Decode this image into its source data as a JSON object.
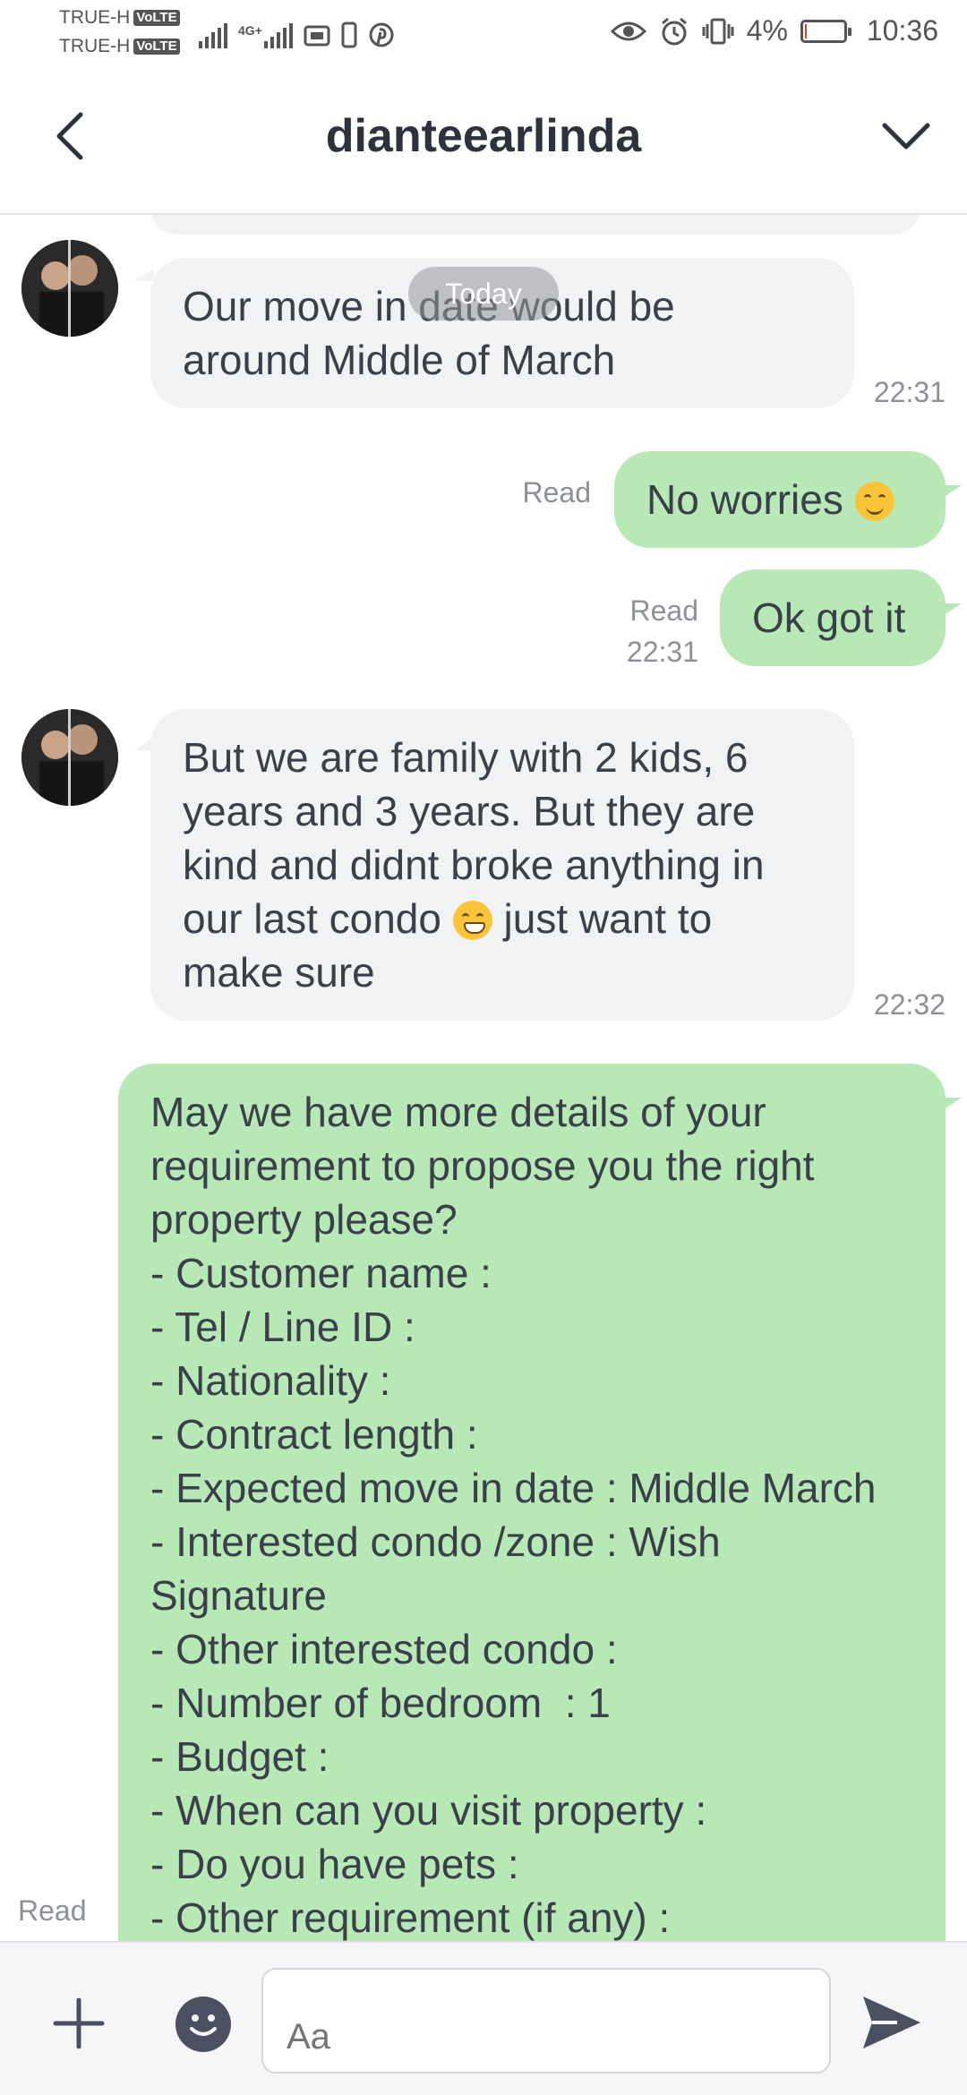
{
  "status_bar": {
    "carrier1": "TRUE-H",
    "carrier2": "TRUE-H",
    "volte": "VoLTE",
    "network": "4G+",
    "battery_percent": "4%",
    "battery_level": 0.04,
    "time": "10:36"
  },
  "header": {
    "title": "dianteearlinda",
    "back_icon": "chevron-left-icon",
    "menu_icon": "chevron-down-icon"
  },
  "chat": {
    "date_pill": "Today",
    "messages": [
      {
        "direction": "incoming",
        "lines": [
          "Our move in date would be",
          "around Middle of March"
        ],
        "time": "22:31"
      },
      {
        "direction": "outgoing",
        "text": "No worries",
        "emoji": "smiling-face-emoji",
        "status": "Read"
      },
      {
        "direction": "outgoing",
        "text": "Ok got it",
        "status": "Read",
        "time": "22:31"
      },
      {
        "direction": "incoming",
        "lines": [
          "But we are family with 2 kids, 6",
          "years and 3 years. But they are",
          "kind and didnt broke anything in",
          "our last condo",
          "just want to",
          "make sure"
        ],
        "emoji": "grinning-face-emoji",
        "time": "22:32"
      },
      {
        "direction": "outgoing",
        "lines": [
          "May we have more details of your",
          "requirement to propose you the right",
          "property please?",
          "- Customer name :",
          "- Tel / Line ID :",
          "- Nationality :",
          "- Contract length :",
          "- Expected move in date : Middle March",
          "- Interested condo /zone : Wish",
          "Signature",
          "- Other interested condo :",
          "- Number of bedroom  : 1",
          "- Budget :",
          "- When can you visit property :",
          "- Do you have pets :",
          "- Other requirement (if any) :"
        ],
        "status": "Read"
      }
    ]
  },
  "composer": {
    "placeholder": "Aa",
    "plus_icon": "plus-icon",
    "sticker_icon": "smiley-icon",
    "send_icon": "send-icon"
  }
}
